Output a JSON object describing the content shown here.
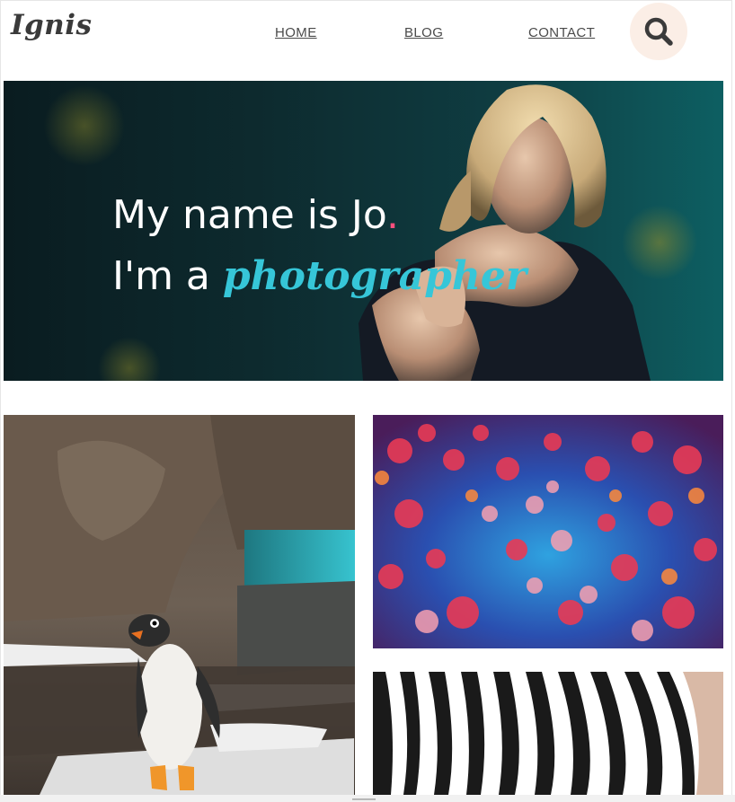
{
  "header": {
    "logo": "Ignis",
    "nav": [
      "HOME",
      "BLOG",
      "CONTACT"
    ],
    "search_icon": "search-icon"
  },
  "hero": {
    "line1_main": "My name is Jo",
    "line1_dot": ".",
    "line2_prefix": "I'm a ",
    "line2_highlight": "photographer",
    "accent": "#36c6d8",
    "dot_color": "#ff4f7d"
  },
  "gallery": {
    "tiles": [
      "penguin-photo",
      "jellyfish-photo",
      "zebra-photo"
    ]
  }
}
